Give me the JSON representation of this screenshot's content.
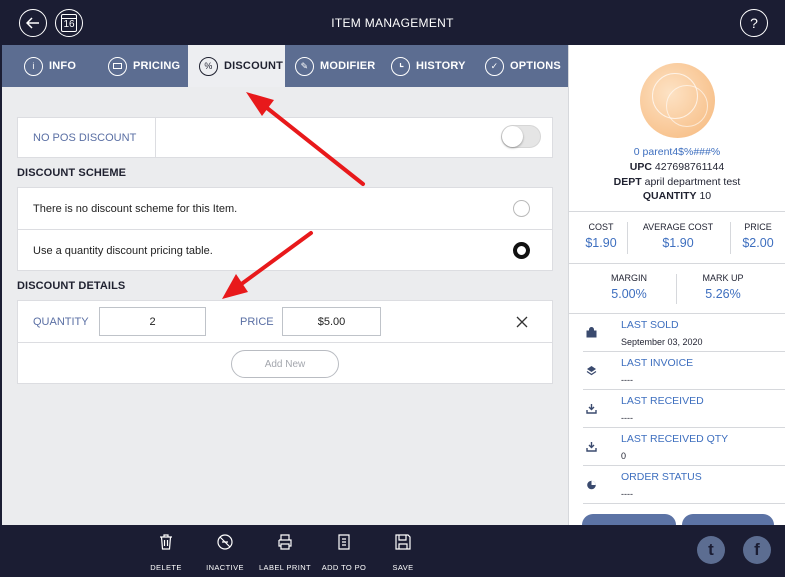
{
  "header": {
    "title": "ITEM MANAGEMENT",
    "calendar_day": "16",
    "help_glyph": "?"
  },
  "tabs": [
    {
      "label": "INFO",
      "icon": "info-icon"
    },
    {
      "label": "PRICING",
      "icon": "pricing-icon"
    },
    {
      "label": "DISCOUNT",
      "icon": "percent-icon",
      "active": true
    },
    {
      "label": "MODIFIER",
      "icon": "pencil-icon"
    },
    {
      "label": "HISTORY",
      "icon": "clock-icon"
    },
    {
      "label": "OPTIONS",
      "icon": "check-icon"
    }
  ],
  "discount": {
    "no_pos_label": "NO POS DISCOUNT",
    "no_pos_enabled": false,
    "scheme_title": "DISCOUNT SCHEME",
    "scheme_options": [
      {
        "label": "There is no discount scheme for this Item.",
        "selected": false
      },
      {
        "label": "Use a quantity discount pricing table.",
        "selected": true
      }
    ],
    "details_title": "DISCOUNT DETAILS",
    "quantity_label": "QUANTITY",
    "quantity_value": "2",
    "price_label": "PRICE",
    "price_value": "$5.00",
    "add_new_label": "Add New"
  },
  "sidebar": {
    "product_name": "0 parent4$%###%",
    "upc_label": "UPC",
    "upc_value": "427698761144",
    "dept_label": "DEPT",
    "dept_value": "april department test",
    "qty_label": "QUANTITY",
    "qty_value": "10",
    "cost_label": "COST",
    "cost_value": "$1.90",
    "avg_cost_label": "AVERAGE COST",
    "avg_cost_value": "$1.90",
    "price_label": "PRICE",
    "price_value": "$2.00",
    "margin_label": "MARGIN",
    "margin_value": "5.00%",
    "markup_label": "MARK UP",
    "markup_value": "5.26%",
    "rows": [
      {
        "title": "LAST SOLD",
        "value": "September 03, 2020",
        "icon": "bag-icon"
      },
      {
        "title": "LAST INVOICE",
        "value": "----",
        "icon": "layers-icon"
      },
      {
        "title": "LAST RECEIVED",
        "value": "----",
        "icon": "receive-icon"
      },
      {
        "title": "LAST RECEIVED QTY",
        "value": "0",
        "icon": "receive-qty-icon"
      },
      {
        "title": "ORDER STATUS",
        "value": "----",
        "icon": "order-status-icon"
      }
    ]
  },
  "bottom_actions": [
    {
      "label": "DELETE",
      "icon": "trash-icon"
    },
    {
      "label": "INACTIVE",
      "icon": "inactive-icon"
    },
    {
      "label": "LABEL PRINT",
      "icon": "printer-icon"
    },
    {
      "label": "ADD TO PO",
      "icon": "add-to-po-icon"
    },
    {
      "label": "SAVE",
      "icon": "save-icon"
    }
  ],
  "social": {
    "twitter_glyph": "t",
    "facebook_glyph": "f"
  },
  "colors": {
    "dark_navy": "#1b1d33",
    "tab_bar": "#5c6d91",
    "accent_blue": "#3e6fbf",
    "annotation_red": "#e8191b"
  }
}
